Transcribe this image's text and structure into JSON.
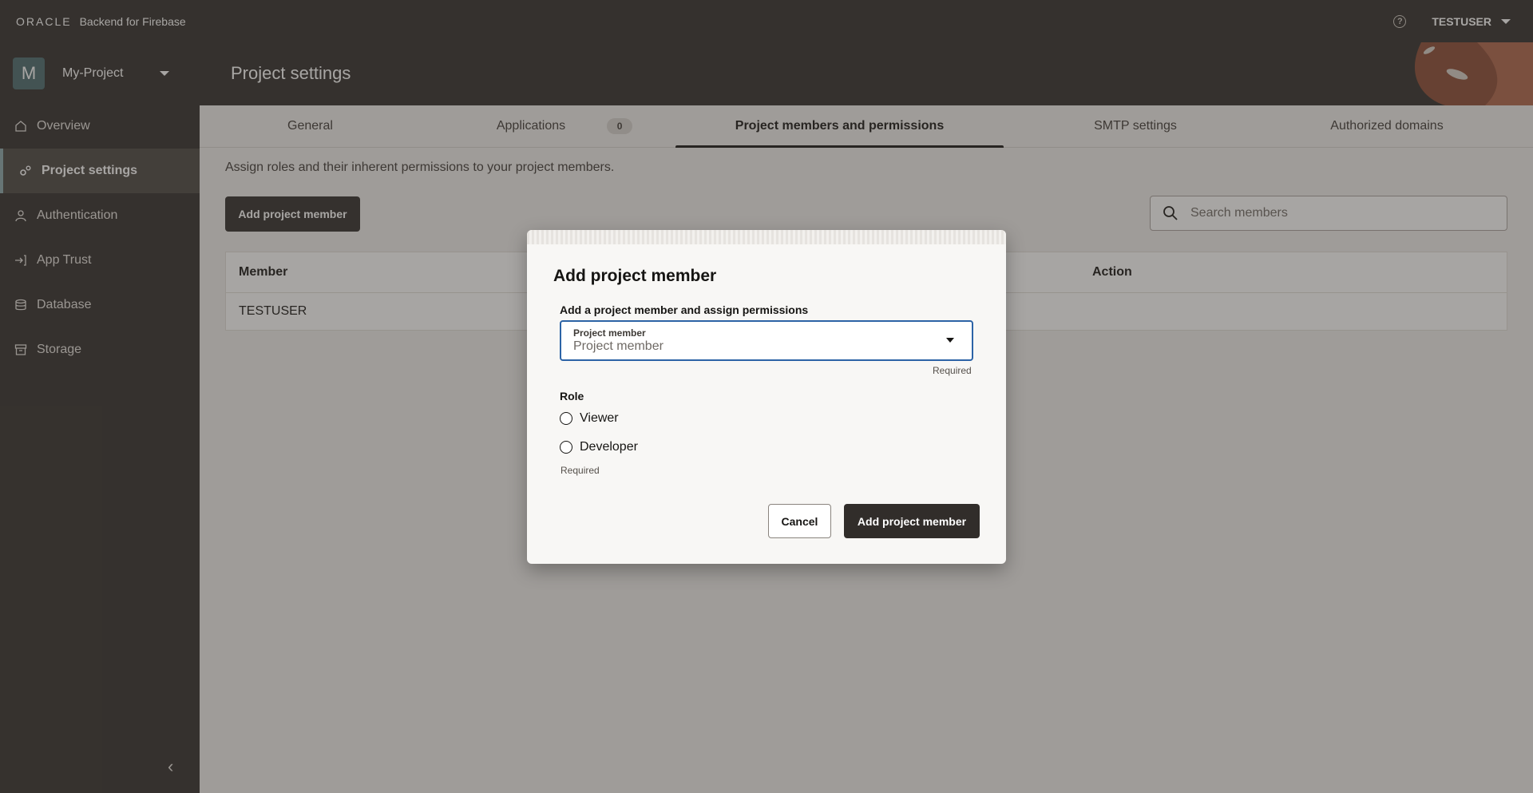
{
  "topbar": {
    "logo_text": "ORACLE",
    "product_name": "Backend for Firebase",
    "help_icon": "question-circle-icon",
    "help_glyph": "?",
    "user_name": "TESTUSER"
  },
  "sidebar": {
    "project_initial": "M",
    "project_name": "My-Project",
    "items": [
      {
        "label": "Overview",
        "icon": "home-icon"
      },
      {
        "label": "Project settings",
        "icon": "gears-icon",
        "active": true
      },
      {
        "label": "Authentication",
        "icon": "user-icon"
      },
      {
        "label": "App Trust",
        "icon": "sign-in-icon"
      },
      {
        "label": "Database",
        "icon": "database-icon"
      },
      {
        "label": "Storage",
        "icon": "archive-icon"
      }
    ],
    "collapse_glyph": "‹"
  },
  "header": {
    "title": "Project settings"
  },
  "tabs": [
    {
      "label": "General"
    },
    {
      "label": "Applications",
      "badge": "0"
    },
    {
      "label": "Project members and permissions",
      "active": true
    },
    {
      "label": "SMTP settings"
    },
    {
      "label": "Authorized domains"
    }
  ],
  "main": {
    "intro": "Assign roles and their inherent permissions to your project members.",
    "add_button": "Add project member",
    "search_placeholder": "Search members",
    "table": {
      "columns": [
        "Member",
        "Action"
      ],
      "rows": [
        {
          "member": "TESTUSER"
        }
      ]
    }
  },
  "dialog": {
    "title": "Add project member",
    "subtitle": "Add a project member and assign permissions",
    "select_label": "Project member",
    "select_placeholder": "Project member",
    "required_text": "Required",
    "role_label": "Role",
    "roles": [
      "Viewer",
      "Developer"
    ],
    "cancel_label": "Cancel",
    "confirm_label": "Add project member"
  },
  "colors": {
    "brand_dark": "#312d2a",
    "focus_blue": "#2c63a6",
    "accent_teal": "#4a6b6e"
  }
}
